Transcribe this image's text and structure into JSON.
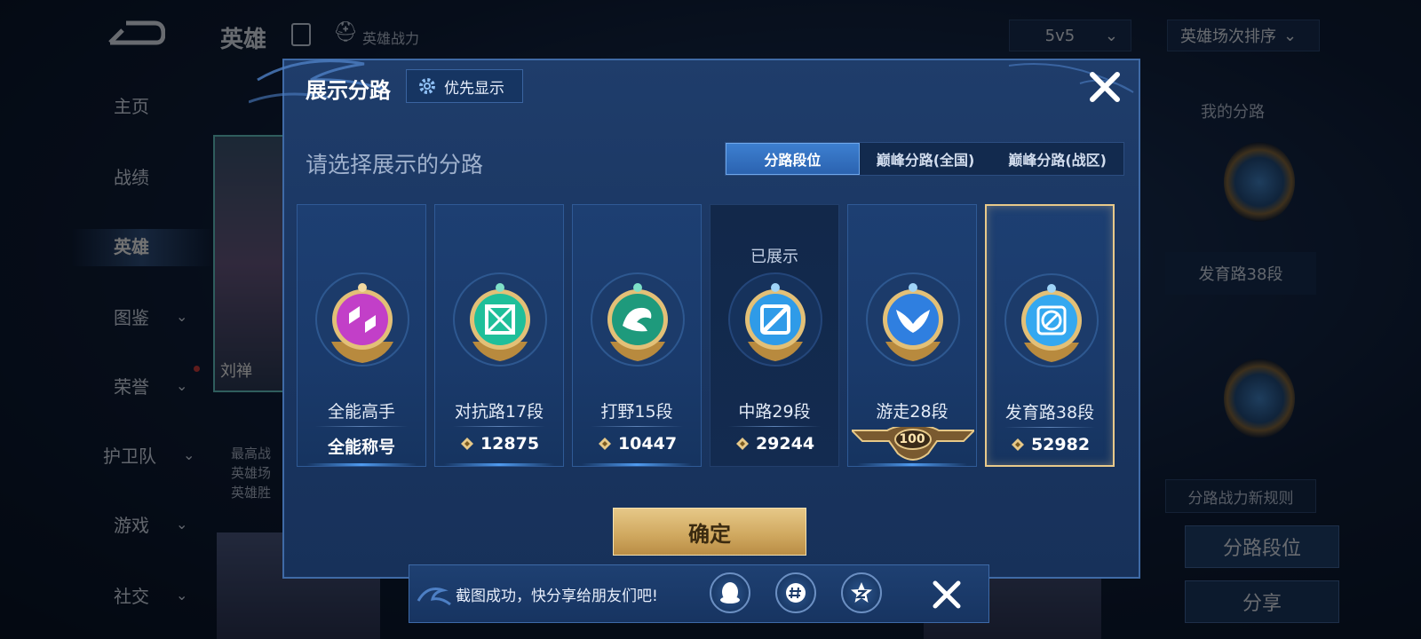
{
  "background": {
    "title": "英雄",
    "power_label": "英雄战力",
    "mode_select": "5v5",
    "sort_select": "英雄场次排序",
    "nav": [
      "主页",
      "战绩",
      "英雄",
      "图鉴",
      "荣誉",
      "护卫队",
      "游戏",
      "社交"
    ],
    "hero_name": "刘禅",
    "hero_desc": [
      "最高战",
      "英雄场",
      "英雄胜"
    ],
    "right_panel": {
      "title": "我的分路",
      "label": "发育路38段",
      "rules": "分路战力新规则",
      "btn_lane": "分路段位",
      "btn_share": "分享"
    }
  },
  "modal": {
    "title": "展示分路",
    "pref_label": "优先显示",
    "subtitle": "请选择展示的分路",
    "tabs": [
      "分路段位",
      "巅峰分路(全国)",
      "巅峰分路(战区)"
    ],
    "active_tab": 0,
    "cards": [
      {
        "name": "全能高手",
        "score": "全能称号",
        "color": "#c23fc8",
        "icon": "all-round-icon",
        "shown": ""
      },
      {
        "name": "对抗路17段",
        "score": "12875",
        "color": "#1fbf9a",
        "icon": "clash-lane-icon",
        "shown": ""
      },
      {
        "name": "打野15段",
        "score": "10447",
        "color": "#1e9a7c",
        "icon": "jungle-dragon-icon",
        "shown": ""
      },
      {
        "name": "中路29段",
        "score": "29244",
        "color": "#2f9be8",
        "icon": "mid-lane-icon",
        "shown": "已展示"
      },
      {
        "name": "游走28段",
        "score": "",
        "color": "#2f7fe0",
        "icon": "roam-wings-icon",
        "shown": "",
        "badge": "100"
      },
      {
        "name": "发育路38段",
        "score": "52982",
        "color": "#34a8f0",
        "icon": "farm-lane-icon",
        "shown": ""
      }
    ],
    "confirm_label": "确定"
  },
  "toast": {
    "text": "截图成功，快分享给朋友们吧!"
  },
  "colors": {
    "accent": "#3d7fd0",
    "gold": "#e6c888"
  }
}
